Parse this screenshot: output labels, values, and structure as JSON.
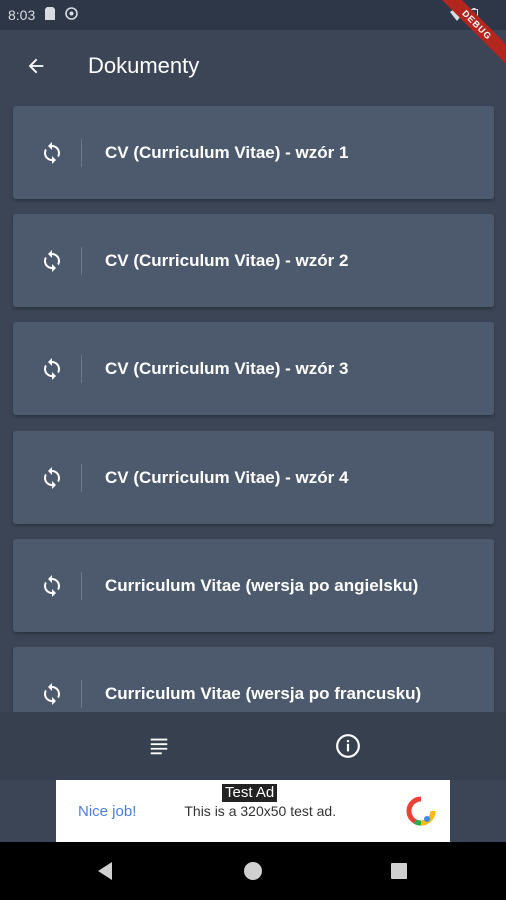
{
  "status_bar": {
    "time": "8:03"
  },
  "debug_banner": "DEBUG",
  "app_bar": {
    "title": "Dokumenty"
  },
  "documents": [
    {
      "label": "CV (Curriculum Vitae) - wzór 1"
    },
    {
      "label": "CV (Curriculum Vitae) - wzór 2"
    },
    {
      "label": "CV (Curriculum Vitae) - wzór 3"
    },
    {
      "label": "CV (Curriculum Vitae) - wzór 4"
    },
    {
      "label": "Curriculum Vitae (wersja po angielsku)"
    },
    {
      "label": "Curriculum Vitae (wersja po francusku)"
    }
  ],
  "bottom_nav": {
    "items": [
      "list-icon",
      "info-icon"
    ]
  },
  "ad": {
    "tag": "Test Ad",
    "left_text": "Nice job!",
    "text": "This is a 320x50 test ad."
  },
  "colors": {
    "background": "#3b4556",
    "card": "#4d5a6d",
    "bottom_nav": "#36404f",
    "debug": "#b3261e"
  }
}
